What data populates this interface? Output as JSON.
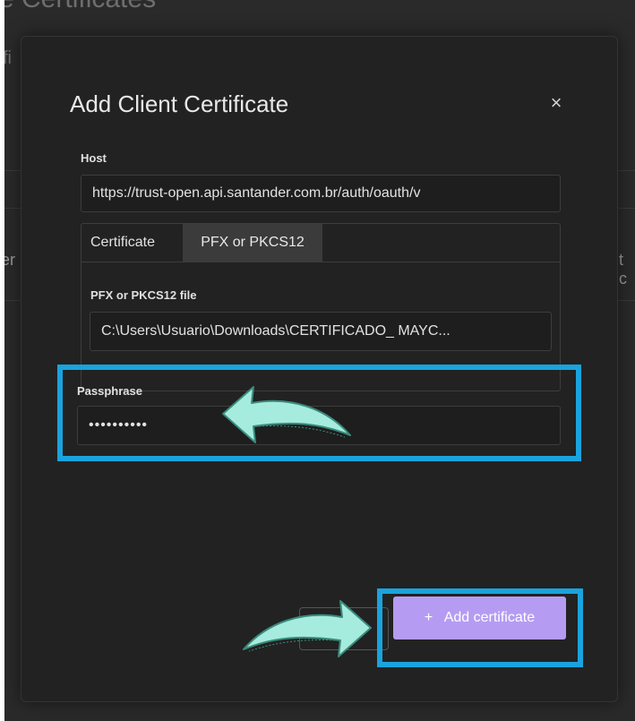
{
  "background": {
    "title": "e Certificates",
    "subtitle": "fi",
    "edge_left": "er",
    "edge_right": "t c"
  },
  "dialog": {
    "title": "Add Client Certificate",
    "close_symbol": "×"
  },
  "host": {
    "label": "Host",
    "value": "https://trust-open.api.santander.com.br/auth/oauth/v"
  },
  "certificate": {
    "label": "Certificate",
    "type_tab": "PFX or PKCS12",
    "file_label": "PFX or PKCS12 file",
    "file_value": "C:\\Users\\Usuario\\Downloads\\CERTIFICADO_ MAYC..."
  },
  "passphrase": {
    "label": "Passphrase",
    "value": "••••••••••"
  },
  "actions": {
    "add_symbol": "+",
    "add_label": "Add certificate"
  },
  "colors": {
    "highlight": "#1aa3de",
    "primary_button": "#b59cf2",
    "arrow_fill": "#a6ecde"
  }
}
